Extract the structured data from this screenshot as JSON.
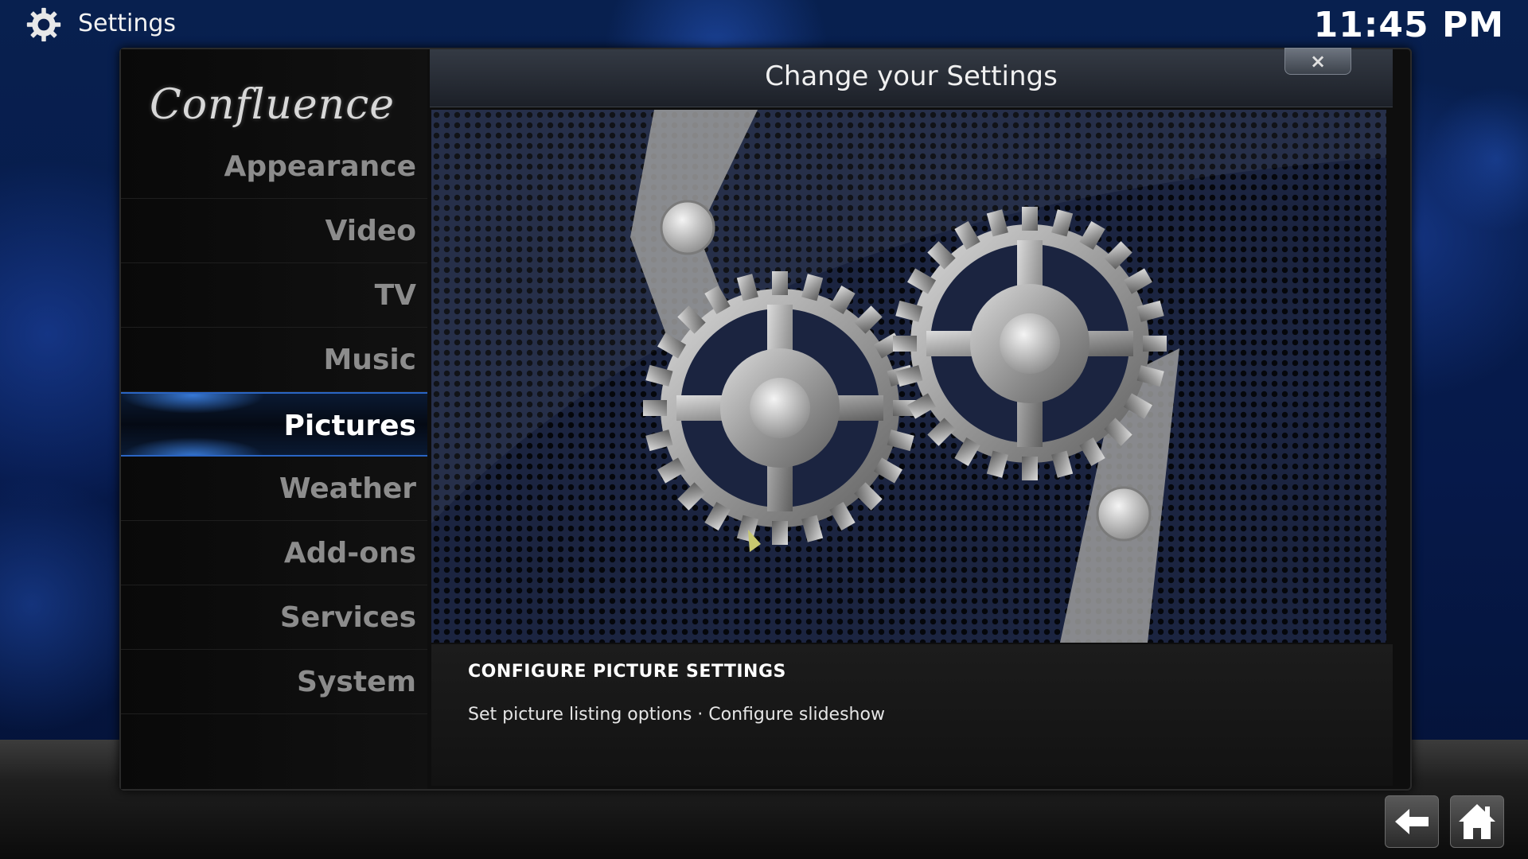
{
  "top_bar": {
    "title": "Settings",
    "icon": "gear-icon",
    "clock": "11:45 PM"
  },
  "sidebar": {
    "logo_text": "Confluence",
    "items": [
      {
        "label": "Appearance",
        "active": false
      },
      {
        "label": "Video",
        "active": false
      },
      {
        "label": "TV",
        "active": false
      },
      {
        "label": "Music",
        "active": false
      },
      {
        "label": "Pictures",
        "active": true
      },
      {
        "label": "Weather",
        "active": false
      },
      {
        "label": "Add-ons",
        "active": false
      },
      {
        "label": "Services",
        "active": false
      },
      {
        "label": "System",
        "active": false
      }
    ]
  },
  "dialog": {
    "title": "Change your Settings",
    "close_label": "×"
  },
  "info": {
    "title": "CONFIGURE PICTURE SETTINGS",
    "description": "Set picture listing options · Configure slideshow"
  },
  "nav": {
    "back_icon": "back-arrow-icon",
    "home_icon": "home-icon"
  },
  "colors": {
    "accent": "#2a65c4",
    "background": "#06194a",
    "menu_text": "#8c8c8c",
    "menu_active_text": "#ffffff"
  }
}
